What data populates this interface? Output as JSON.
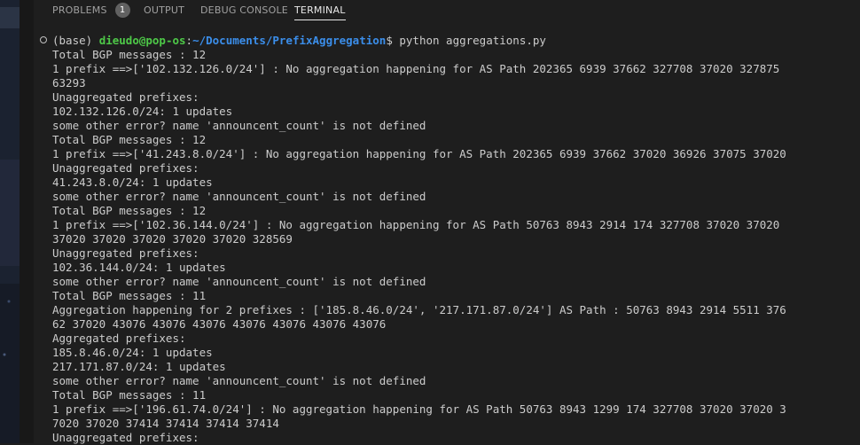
{
  "panel_tabs": {
    "problems": "PROBLEMS",
    "problems_count": "1",
    "output": "OUTPUT",
    "debug_console": "DEBUG CONSOLE",
    "terminal": "TERMINAL"
  },
  "prompt": {
    "env": "(base) ",
    "user_host": "dieudo@pop-os",
    "colon": ":",
    "cwd": "~/Documents/PrefixAggregation",
    "symbol": "$ ",
    "command": "python aggregations.py"
  },
  "output_lines": [
    "Total BGP messages : 12",
    "1 prefix ==>['102.132.126.0/24'] : No aggregation happening for AS Path 202365 6939 37662 327708 37020 327875",
    "63293",
    "Unaggregated prefixes:",
    "102.132.126.0/24: 1 updates",
    "some other error? name 'announcent_count' is not defined",
    "Total BGP messages : 12",
    "1 prefix ==>['41.243.8.0/24'] : No aggregation happening for AS Path 202365 6939 37662 37020 36926 37075 37020",
    "Unaggregated prefixes:",
    "41.243.8.0/24: 1 updates",
    "some other error? name 'announcent_count' is not defined",
    "Total BGP messages : 12",
    "1 prefix ==>['102.36.144.0/24'] : No aggregation happening for AS Path 50763 8943 2914 174 327708 37020 37020",
    "37020 37020 37020 37020 37020 328569",
    "Unaggregated prefixes:",
    "102.36.144.0/24: 1 updates",
    "some other error? name 'announcent_count' is not defined",
    "Total BGP messages : 11",
    "Aggregation happening for 2 prefixes : ['185.8.46.0/24', '217.171.87.0/24'] AS Path : 50763 8943 2914 5511 376",
    "62 37020 43076 43076 43076 43076 43076 43076 43076",
    "Aggregated prefixes:",
    "185.8.46.0/24: 1 updates",
    "217.171.87.0/24: 1 updates",
    "some other error? name 'announcent_count' is not defined",
    "Total BGP messages : 11",
    "1 prefix ==>['196.61.74.0/24'] : No aggregation happening for AS Path 50763 8943 1299 174 327708 37020 37020 3",
    "7020 37020 37414 37414 37414 37414",
    "Unaggregated prefixes:"
  ]
}
